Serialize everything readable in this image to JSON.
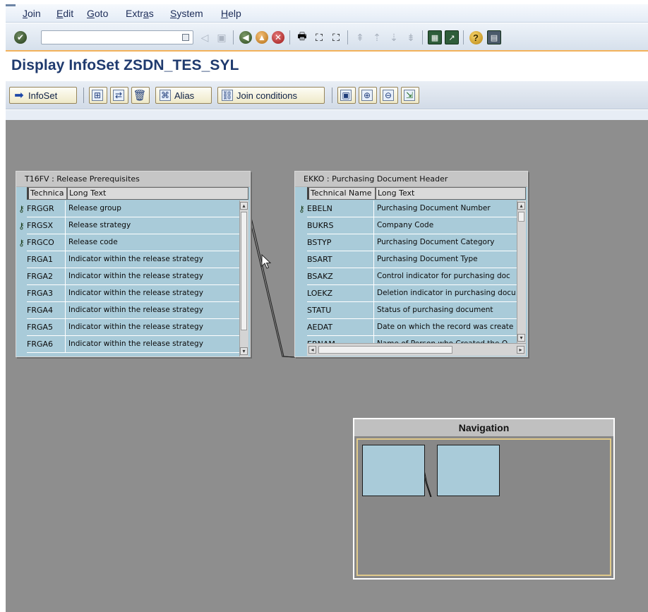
{
  "menubar": {
    "items": [
      {
        "label": "Join",
        "ul": "J",
        "rest": "oin"
      },
      {
        "label": "Edit",
        "ul": "E",
        "rest": "dit"
      },
      {
        "label": "Goto",
        "ul": "G",
        "rest": "oto"
      },
      {
        "label": "Extras",
        "ul": "",
        "pre": "Extr",
        "mid": "a",
        "post": "s"
      },
      {
        "label": "System",
        "ul": "S",
        "rest": "ystem"
      },
      {
        "label": "Help",
        "ul": "H",
        "rest": "elp"
      }
    ]
  },
  "toolbar": {
    "command_field_value": ""
  },
  "title": "Display InfoSet ZSDN_TES_SYL",
  "app_toolbar": {
    "infoset_label": "InfoSet",
    "alias_label": "Alias",
    "join_conditions_label": "Join conditions"
  },
  "left_table": {
    "title": "T16FV : Release Prerequisites",
    "col1_header": "Technica",
    "col2_header": "Long Text",
    "rows": [
      {
        "tech": "FRGGR",
        "text": "Release group",
        "key": true
      },
      {
        "tech": "FRGSX",
        "text": "Release strategy",
        "key": true
      },
      {
        "tech": "FRGCO",
        "text": "Release code",
        "key": true
      },
      {
        "tech": "FRGA1",
        "text": "Indicator within the release strategy",
        "key": false
      },
      {
        "tech": "FRGA2",
        "text": "Indicator within the release strategy",
        "key": false
      },
      {
        "tech": "FRGA3",
        "text": "Indicator within the release strategy",
        "key": false
      },
      {
        "tech": "FRGA4",
        "text": "Indicator within the release strategy",
        "key": false
      },
      {
        "tech": "FRGA5",
        "text": "Indicator within the release strategy",
        "key": false
      },
      {
        "tech": "FRGA6",
        "text": "Indicator within the release strategy",
        "key": false
      }
    ]
  },
  "right_table": {
    "title": "EKKO : Purchasing Document Header",
    "col1_header": "Technical Name",
    "col2_header": "Long Text",
    "rows": [
      {
        "tech": "EBELN",
        "text": "Purchasing Document Number",
        "key": true
      },
      {
        "tech": "BUKRS",
        "text": "Company Code",
        "key": false
      },
      {
        "tech": "BSTYP",
        "text": "Purchasing Document Category",
        "key": false
      },
      {
        "tech": "BSART",
        "text": "Purchasing Document Type",
        "key": false
      },
      {
        "tech": "BSAKZ",
        "text": "Control indicator for purchasing doc",
        "key": false
      },
      {
        "tech": "LOEKZ",
        "text": "Deletion indicator in purchasing docu",
        "key": false
      },
      {
        "tech": "STATU",
        "text": "Status of purchasing document",
        "key": false
      },
      {
        "tech": "AEDAT",
        "text": "Date on which the record was create",
        "key": false
      },
      {
        "tech": "ERNAM",
        "text": "Name of Person who Created the O",
        "key": false
      }
    ]
  },
  "navigation": {
    "title": "Navigation"
  }
}
